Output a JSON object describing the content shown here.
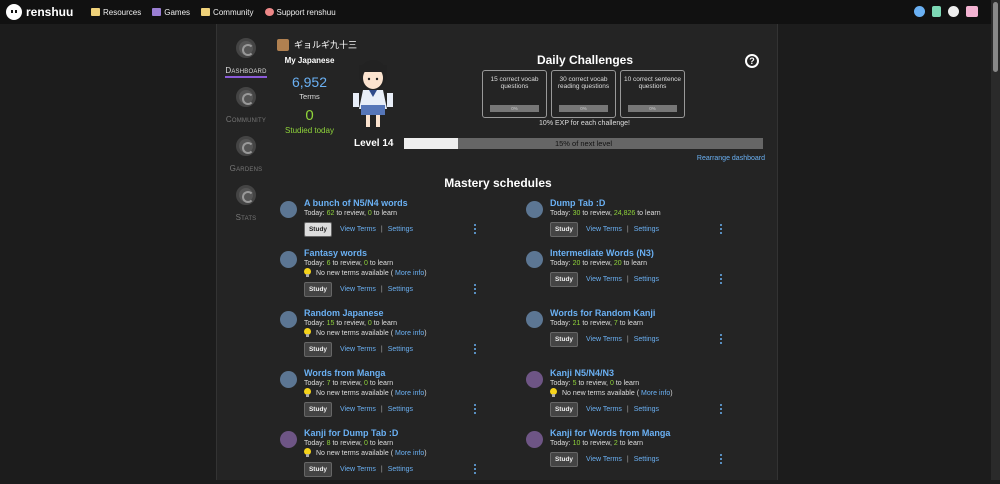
{
  "topbar": {
    "logo_text": "renshuu",
    "nav": [
      {
        "label": "Resources",
        "icon": "folder-icon",
        "color": "#f0d27a"
      },
      {
        "label": "Games",
        "icon": "dice-icon",
        "color": "#9b7fd4"
      },
      {
        "label": "Community",
        "icon": "chat-icon",
        "color": "#f0d27a"
      },
      {
        "label": "Support renshuu",
        "icon": "heart-icon",
        "color": "#e55"
      }
    ]
  },
  "sidenav": [
    {
      "label": "Dashboard",
      "active": true
    },
    {
      "label": "Community",
      "active": false
    },
    {
      "label": "Gardens",
      "active": false
    },
    {
      "label": "Stats",
      "active": false
    }
  ],
  "user": {
    "name": "ギョルギ九十三"
  },
  "my_language": {
    "title": "My Japanese",
    "terms_count": "6,952",
    "terms_label": "Terms",
    "studied_count": "0",
    "studied_label": "Studied today"
  },
  "daily": {
    "title": "Daily Challenges",
    "help": "?",
    "challenges": [
      {
        "text": "15 correct vocab questions",
        "progress": "0%"
      },
      {
        "text": "30 correct vocab reading questions",
        "progress": "0%"
      },
      {
        "text": "10 correct sentence questions",
        "progress": "0%"
      }
    ],
    "exp_note": "10% EXP for each challenge!"
  },
  "level": {
    "label": "Level 14",
    "progress_text": "15% of next level",
    "progress_fraction": 0.15
  },
  "rearrange": "Rearrange dashboard",
  "mastery": {
    "title": "Mastery schedules",
    "labels": {
      "study": "Study",
      "view_terms": "View Terms",
      "sep": "|",
      "settings": "Settings",
      "today": "Today:",
      "to_review": "to review,",
      "to_learn": "to learn",
      "no_new": "No new terms available",
      "more_info": "More info"
    },
    "left": [
      {
        "name": "A bunch of N5/N4 words",
        "review": "62",
        "learn": "0",
        "no_new": false,
        "color": "blue",
        "study_light": true
      },
      {
        "name": "Fantasy words",
        "review": "6",
        "learn": "0",
        "no_new": true,
        "color": "blue"
      },
      {
        "name": "Random Japanese",
        "review": "15",
        "learn": "0",
        "no_new": true,
        "color": "blue"
      },
      {
        "name": "Words from Manga",
        "review": "7",
        "learn": "0",
        "no_new": true,
        "color": "blue"
      },
      {
        "name": "Kanji for Dump Tab :D",
        "review": "8",
        "learn": "0",
        "no_new": true,
        "color": "purple"
      }
    ],
    "right": [
      {
        "name": "Dump Tab :D",
        "review": "30",
        "learn": "24,826",
        "no_new": false,
        "color": "blue"
      },
      {
        "name": "Intermediate Words (N3)",
        "review": "20",
        "learn": "20",
        "no_new": false,
        "color": "blue"
      },
      {
        "name": "Words for Random Kanji",
        "review": "21",
        "learn": "7",
        "no_new": false,
        "color": "blue"
      },
      {
        "name": "Kanji N5/N4/N3",
        "review": "5",
        "learn": "0",
        "no_new": true,
        "color": "purple"
      },
      {
        "name": "Kanji for Words from Manga",
        "review": "10",
        "learn": "2",
        "no_new": false,
        "color": "purple"
      }
    ]
  }
}
